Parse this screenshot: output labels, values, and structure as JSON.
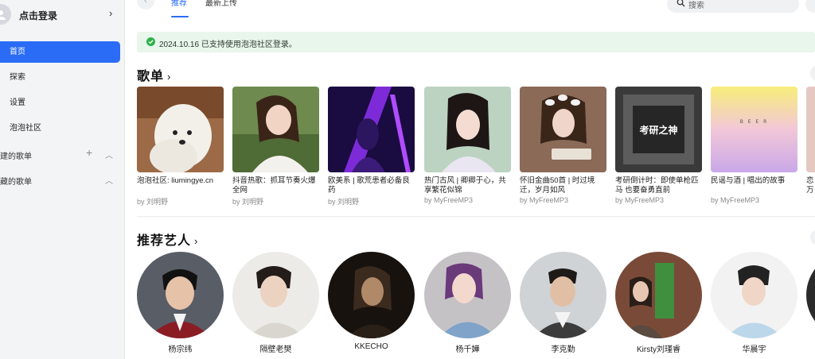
{
  "sidebar": {
    "login_label": "点击登录",
    "nav": [
      {
        "label": "首页",
        "active": true
      },
      {
        "label": "探索",
        "active": false
      },
      {
        "label": "设置",
        "active": false
      },
      {
        "label": "泡泡社区",
        "active": false
      }
    ],
    "created_label": "建的歌单",
    "favorited_label": "藏的歌单",
    "accent": "#2b6cf6"
  },
  "topbar": {
    "tabs": [
      "推荐",
      "最新上传"
    ],
    "search_placeholder": "搜索"
  },
  "notice": {
    "text": "2024.10.16 已支持使用泡泡社区登录。",
    "color": "#e9f6ec"
  },
  "playlists": {
    "heading": "歌单",
    "items": [
      {
        "title": "泡泡社区: liumingye.cn",
        "author": "by 刘明野"
      },
      {
        "title": "抖音热歌：抓耳节奏火爆全网",
        "author": "by 刘明野"
      },
      {
        "title": "欧美系 | 歌荒患者必备良药",
        "author": "by 刘明野"
      },
      {
        "title": "热门古风 | 卿卿于心，共享繁花似锦",
        "author": "by MyFreeMP3"
      },
      {
        "title": "怀旧金曲50首 | 时过境迁，岁月如风",
        "author": "by MyFreeMP3"
      },
      {
        "title": "考研倒计时：即使单枪匹马 也要奋勇直前",
        "author": "by MyFreeMP3"
      },
      {
        "title": "民谣与酒 | 唱出的故事",
        "author": "by MyFreeMP3"
      },
      {
        "title": "恋万",
        "author": ""
      }
    ],
    "cover_texts": {
      "kaoyan": "考研之神",
      "dream": "B E E R"
    }
  },
  "artists": {
    "heading": "推荐艺人",
    "items": [
      {
        "name": "杨宗纬"
      },
      {
        "name": "隔壁老樊"
      },
      {
        "name": "KKECHO"
      },
      {
        "name": "杨千嬅"
      },
      {
        "name": "李克勤"
      },
      {
        "name": "Kirsty刘瑾睿"
      },
      {
        "name": "华晨宇"
      }
    ]
  }
}
